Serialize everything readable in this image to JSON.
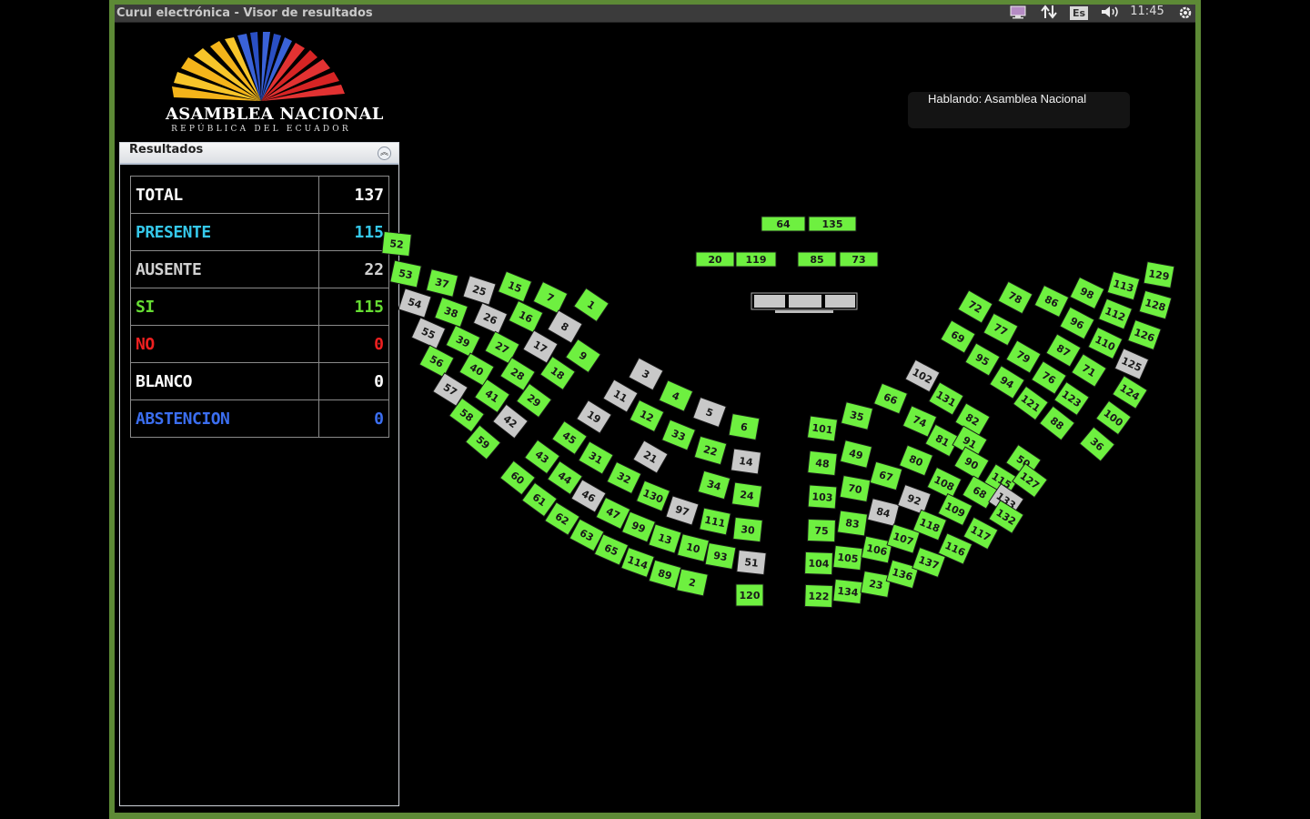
{
  "window": {
    "title": "Curul electrónica - Visor de resultados"
  },
  "tray": {
    "keyboard_layout": "Es",
    "clock": "11:45",
    "icons": [
      "monitor-icon",
      "network-icon",
      "volume-icon",
      "gear-icon"
    ]
  },
  "logo": {
    "name": "ASAMBLEA NACIONAL",
    "subtitle": "REPÚBLICA DEL ECUADOR"
  },
  "panel": {
    "title": "Resultados",
    "rows": [
      {
        "label": "TOTAL",
        "value": "137",
        "color": "#ffffff"
      },
      {
        "label": "PRESENTE",
        "value": "115",
        "color": "#35c8ea"
      },
      {
        "label": "AUSENTE",
        "value": "22",
        "color": "#d0d0d0"
      },
      {
        "label": "SI",
        "value": "115",
        "color": "#66dd33"
      },
      {
        "label": "NO",
        "value": "0",
        "color": "#ee2020"
      },
      {
        "label": "BLANCO",
        "value": "0",
        "color": "#ffffff"
      },
      {
        "label": "ABSTENCION",
        "value": "0",
        "color": "#3b6ef0"
      }
    ]
  },
  "speaker": {
    "text": "Hablando: Asamblea Nacional"
  },
  "colors": {
    "seat_si": "#6ef040",
    "seat_absent": "#c8c8c8",
    "frame": "#5d8a36"
  },
  "seats": [
    {
      "n": "64",
      "s": "si"
    },
    {
      "n": "135",
      "s": "si"
    },
    {
      "n": "20",
      "s": "si"
    },
    {
      "n": "119",
      "s": "si"
    },
    {
      "n": "85",
      "s": "si"
    },
    {
      "n": "73",
      "s": "si"
    },
    {
      "n": "52",
      "s": "si"
    },
    {
      "n": "53",
      "s": "si"
    },
    {
      "n": "54",
      "s": "absent"
    },
    {
      "n": "55",
      "s": "absent"
    },
    {
      "n": "56",
      "s": "si"
    },
    {
      "n": "57",
      "s": "absent"
    },
    {
      "n": "58",
      "s": "si"
    },
    {
      "n": "59",
      "s": "si"
    },
    {
      "n": "37",
      "s": "si"
    },
    {
      "n": "38",
      "s": "si"
    },
    {
      "n": "39",
      "s": "si"
    },
    {
      "n": "40",
      "s": "si"
    },
    {
      "n": "41",
      "s": "si"
    },
    {
      "n": "42",
      "s": "absent"
    },
    {
      "n": "25",
      "s": "absent"
    },
    {
      "n": "26",
      "s": "absent"
    },
    {
      "n": "27",
      "s": "si"
    },
    {
      "n": "28",
      "s": "si"
    },
    {
      "n": "29",
      "s": "si"
    },
    {
      "n": "15",
      "s": "si"
    },
    {
      "n": "16",
      "s": "si"
    },
    {
      "n": "17",
      "s": "absent"
    },
    {
      "n": "18",
      "s": "si"
    },
    {
      "n": "7",
      "s": "si"
    },
    {
      "n": "8",
      "s": "absent"
    },
    {
      "n": "9",
      "s": "si"
    },
    {
      "n": "1",
      "s": "si"
    },
    {
      "n": "3",
      "s": "absent"
    },
    {
      "n": "4",
      "s": "si"
    },
    {
      "n": "5",
      "s": "absent"
    },
    {
      "n": "6",
      "s": "si"
    },
    {
      "n": "11",
      "s": "absent"
    },
    {
      "n": "12",
      "s": "si"
    },
    {
      "n": "33",
      "s": "si"
    },
    {
      "n": "22",
      "s": "si"
    },
    {
      "n": "14",
      "s": "absent"
    },
    {
      "n": "19",
      "s": "absent"
    },
    {
      "n": "21",
      "s": "absent"
    },
    {
      "n": "45",
      "s": "si"
    },
    {
      "n": "31",
      "s": "si"
    },
    {
      "n": "32",
      "s": "si"
    },
    {
      "n": "130",
      "s": "si"
    },
    {
      "n": "97",
      "s": "absent"
    },
    {
      "n": "111",
      "s": "si"
    },
    {
      "n": "30",
      "s": "si"
    },
    {
      "n": "34",
      "s": "si"
    },
    {
      "n": "24",
      "s": "si"
    },
    {
      "n": "43",
      "s": "si"
    },
    {
      "n": "44",
      "s": "si"
    },
    {
      "n": "46",
      "s": "absent"
    },
    {
      "n": "47",
      "s": "si"
    },
    {
      "n": "99",
      "s": "si"
    },
    {
      "n": "13",
      "s": "si"
    },
    {
      "n": "10",
      "s": "si"
    },
    {
      "n": "93",
      "s": "si"
    },
    {
      "n": "51",
      "s": "absent"
    },
    {
      "n": "60",
      "s": "si"
    },
    {
      "n": "61",
      "s": "si"
    },
    {
      "n": "62",
      "s": "si"
    },
    {
      "n": "63",
      "s": "si"
    },
    {
      "n": "65",
      "s": "si"
    },
    {
      "n": "114",
      "s": "si"
    },
    {
      "n": "89",
      "s": "si"
    },
    {
      "n": "2",
      "s": "si"
    },
    {
      "n": "120",
      "s": "si"
    },
    {
      "n": "101",
      "s": "si"
    },
    {
      "n": "35",
      "s": "si"
    },
    {
      "n": "66",
      "s": "si"
    },
    {
      "n": "102",
      "s": "absent"
    },
    {
      "n": "48",
      "s": "si"
    },
    {
      "n": "49",
      "s": "si"
    },
    {
      "n": "74",
      "s": "si"
    },
    {
      "n": "131",
      "s": "si"
    },
    {
      "n": "82",
      "s": "si"
    },
    {
      "n": "103",
      "s": "si"
    },
    {
      "n": "70",
      "s": "si"
    },
    {
      "n": "67",
      "s": "si"
    },
    {
      "n": "80",
      "s": "si"
    },
    {
      "n": "81",
      "s": "si"
    },
    {
      "n": "91",
      "s": "si"
    },
    {
      "n": "75",
      "s": "si"
    },
    {
      "n": "83",
      "s": "si"
    },
    {
      "n": "84",
      "s": "absent"
    },
    {
      "n": "92",
      "s": "absent"
    },
    {
      "n": "108",
      "s": "si"
    },
    {
      "n": "90",
      "s": "si"
    },
    {
      "n": "115",
      "s": "si"
    },
    {
      "n": "50",
      "s": "si"
    },
    {
      "n": "104",
      "s": "si"
    },
    {
      "n": "105",
      "s": "si"
    },
    {
      "n": "106",
      "s": "si"
    },
    {
      "n": "107",
      "s": "si"
    },
    {
      "n": "118",
      "s": "si"
    },
    {
      "n": "109",
      "s": "si"
    },
    {
      "n": "68",
      "s": "si"
    },
    {
      "n": "133",
      "s": "absent"
    },
    {
      "n": "127",
      "s": "si"
    },
    {
      "n": "122",
      "s": "si"
    },
    {
      "n": "134",
      "s": "si"
    },
    {
      "n": "23",
      "s": "si"
    },
    {
      "n": "136",
      "s": "si"
    },
    {
      "n": "137",
      "s": "si"
    },
    {
      "n": "116",
      "s": "si"
    },
    {
      "n": "117",
      "s": "si"
    },
    {
      "n": "132",
      "s": "si"
    },
    {
      "n": "72",
      "s": "si"
    },
    {
      "n": "69",
      "s": "si"
    },
    {
      "n": "78",
      "s": "si"
    },
    {
      "n": "77",
      "s": "si"
    },
    {
      "n": "95",
      "s": "si"
    },
    {
      "n": "86",
      "s": "si"
    },
    {
      "n": "79",
      "s": "si"
    },
    {
      "n": "94",
      "s": "si"
    },
    {
      "n": "76",
      "s": "si"
    },
    {
      "n": "121",
      "s": "si"
    },
    {
      "n": "98",
      "s": "si"
    },
    {
      "n": "96",
      "s": "si"
    },
    {
      "n": "87",
      "s": "si"
    },
    {
      "n": "71",
      "s": "si"
    },
    {
      "n": "123",
      "s": "si"
    },
    {
      "n": "88",
      "s": "si"
    },
    {
      "n": "113",
      "s": "si"
    },
    {
      "n": "112",
      "s": "si"
    },
    {
      "n": "110",
      "s": "si"
    },
    {
      "n": "124",
      "s": "si"
    },
    {
      "n": "100",
      "s": "si"
    },
    {
      "n": "36",
      "s": "si"
    },
    {
      "n": "129",
      "s": "si"
    },
    {
      "n": "128",
      "s": "si"
    },
    {
      "n": "126",
      "s": "si"
    },
    {
      "n": "125",
      "s": "absent"
    }
  ]
}
